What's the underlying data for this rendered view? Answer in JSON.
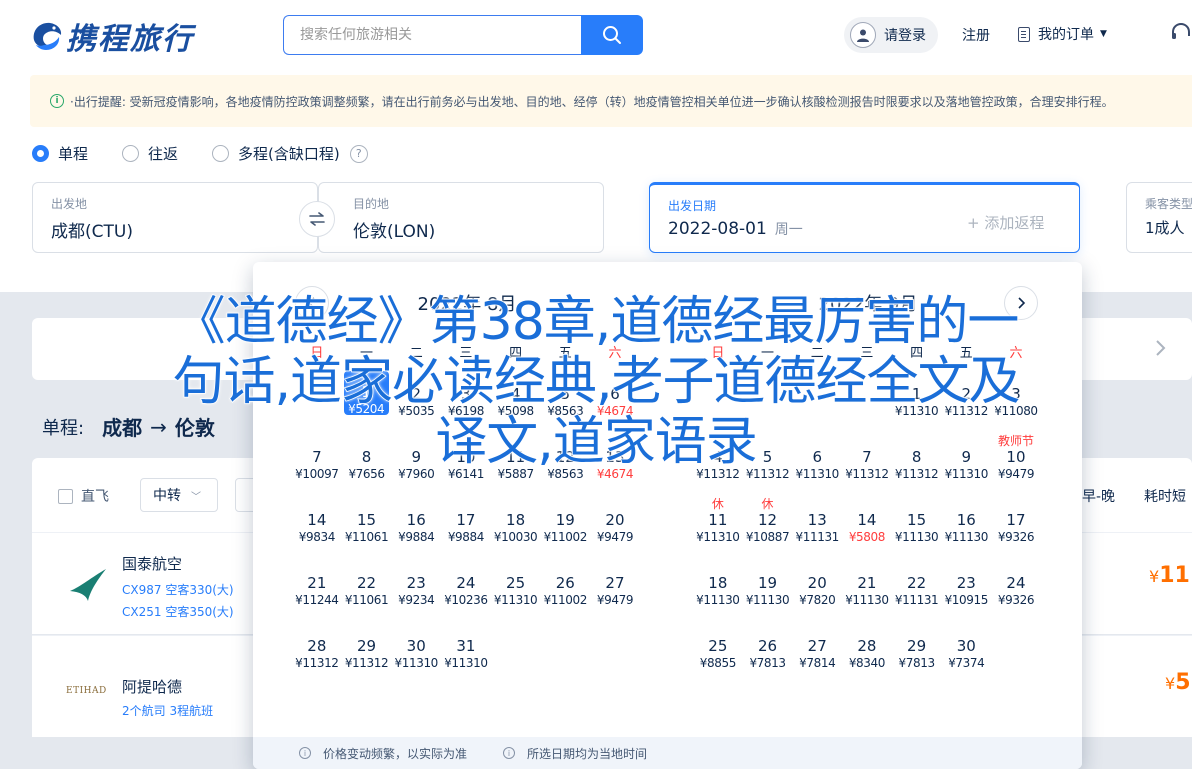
{
  "header": {
    "logo_text": "携程旅行",
    "search_placeholder": "搜索任何旅游相关",
    "login": "请登录",
    "register": "注册",
    "orders": "我的订单"
  },
  "notice": {
    "text": "·出行提醒: 受新冠疫情影响，各地疫情防控政策调整频繁，请在出行前务必与出发地、目的地、经停（转）地疫情管控相关单位进一步确认核酸检测报告时限要求以及落地管控政策，合理安排行程。"
  },
  "trip_types": [
    {
      "label": "单程",
      "checked": true
    },
    {
      "label": "往返",
      "checked": false
    },
    {
      "label": "多程(含缺口程)",
      "checked": false
    }
  ],
  "search": {
    "from_label": "出发地",
    "from_value": "成都(CTU)",
    "to_label": "目的地",
    "to_value": "伦敦(LON)",
    "date_label": "出发日期",
    "date_value": "2022-08-01",
    "date_weekday": "周一",
    "add_return": "+ 添加返程",
    "passenger_label": "乘客类型",
    "passenger_value": "1成人"
  },
  "calendar": {
    "weekdays": [
      "日",
      "一",
      "二",
      "三",
      "四",
      "五",
      "六"
    ],
    "months": [
      {
        "title": "2022年 8月",
        "days": [
          {
            "blank": 1
          },
          {
            "num": "1",
            "price": "¥5204",
            "selected": true
          },
          {
            "num": "2",
            "price": "¥5035"
          },
          {
            "num": "3",
            "price": "¥6198"
          },
          {
            "num": "4",
            "price": "¥5098"
          },
          {
            "num": "5",
            "price": "¥8563"
          },
          {
            "num": "6",
            "price": "¥4674",
            "low": true
          },
          {
            "num": "7",
            "price": "¥10097"
          },
          {
            "num": "8",
            "price": "¥7656"
          },
          {
            "num": "9",
            "price": "¥7960"
          },
          {
            "num": "10",
            "price": "¥6141"
          },
          {
            "num": "11",
            "price": "¥5887"
          },
          {
            "num": "12",
            "price": "¥8563"
          },
          {
            "num": "13",
            "price": "¥4674",
            "low": true
          },
          {
            "num": "14",
            "price": "¥9834"
          },
          {
            "num": "15",
            "price": "¥11061"
          },
          {
            "num": "16",
            "price": "¥9884"
          },
          {
            "num": "17",
            "price": "¥9884"
          },
          {
            "num": "18",
            "price": "¥10030"
          },
          {
            "num": "19",
            "price": "¥11002"
          },
          {
            "num": "20",
            "price": "¥9479"
          },
          {
            "num": "21",
            "price": "¥11244"
          },
          {
            "num": "22",
            "price": "¥11061"
          },
          {
            "num": "23",
            "price": "¥9234"
          },
          {
            "num": "24",
            "price": "¥10236"
          },
          {
            "num": "25",
            "price": "¥11310"
          },
          {
            "num": "26",
            "price": "¥11002"
          },
          {
            "num": "27",
            "price": "¥9479"
          },
          {
            "num": "28",
            "price": "¥11312"
          },
          {
            "num": "29",
            "price": "¥11312"
          },
          {
            "num": "30",
            "price": "¥11310"
          },
          {
            "num": "31",
            "price": "¥11310"
          }
        ]
      },
      {
        "title": "2022年 9月",
        "days": [
          {
            "blank": 4
          },
          {
            "num": "1",
            "price": "¥11310"
          },
          {
            "num": "2",
            "price": "¥11312"
          },
          {
            "num": "3",
            "price": "¥11080"
          },
          {
            "num": "4",
            "price": "¥11312"
          },
          {
            "num": "5",
            "price": "¥11312"
          },
          {
            "num": "6",
            "price": "¥11310"
          },
          {
            "num": "7",
            "price": "¥11312"
          },
          {
            "num": "8",
            "price": "¥11312"
          },
          {
            "num": "9",
            "price": "¥11310"
          },
          {
            "num": "10",
            "price": "¥9479",
            "tag": "教师节"
          },
          {
            "num": "11",
            "price": "¥11310",
            "tag": "休"
          },
          {
            "num": "12",
            "price": "¥10887",
            "tag": "休"
          },
          {
            "num": "13",
            "price": "¥11131"
          },
          {
            "num": "14",
            "price": "¥5808",
            "low": true
          },
          {
            "num": "15",
            "price": "¥11130"
          },
          {
            "num": "16",
            "price": "¥11130"
          },
          {
            "num": "17",
            "price": "¥9326"
          },
          {
            "num": "18",
            "price": "¥11130"
          },
          {
            "num": "19",
            "price": "¥11130"
          },
          {
            "num": "20",
            "price": "¥7820"
          },
          {
            "num": "21",
            "price": "¥11130"
          },
          {
            "num": "22",
            "price": "¥11131"
          },
          {
            "num": "23",
            "price": "¥10915"
          },
          {
            "num": "24",
            "price": "¥9326"
          },
          {
            "num": "25",
            "price": "¥8855"
          },
          {
            "num": "26",
            "price": "¥7813"
          },
          {
            "num": "27",
            "price": "¥7814"
          },
          {
            "num": "28",
            "price": "¥8340"
          },
          {
            "num": "29",
            "price": "¥7813"
          },
          {
            "num": "30",
            "price": "¥7374"
          }
        ]
      }
    ],
    "footer_left": "价格变动频繁，以实际为准",
    "footer_right": "所选日期均为当地时间"
  },
  "results": {
    "route_prefix": "单程:",
    "route_from": "成都",
    "route_arrow": "→",
    "route_to": "伦敦",
    "filter_direct": "直飞",
    "filter_transfer": "中转",
    "sort_a": "早-晚",
    "sort_b": "耗时短",
    "flights": [
      {
        "airline": "国泰航空",
        "sub1": "CX987 空客330(大)",
        "sub2": "CX251 空客350(大)",
        "price": "11"
      },
      {
        "airline": "阿提哈德",
        "sub1": "2个航司  3程航班",
        "price": "5"
      }
    ],
    "currency": "¥"
  },
  "overlay": {
    "line1": "《道德经》第38章,道德经最厉害的一",
    "line2": "句话,道家必读经典,老子道德经全文及",
    "line3": "译文,道家语录"
  },
  "colors": {
    "accent": "#287dfa",
    "price": "#ff6f00",
    "holiday": "#ff3d3d",
    "overlay_text": "#1a6ed8"
  }
}
